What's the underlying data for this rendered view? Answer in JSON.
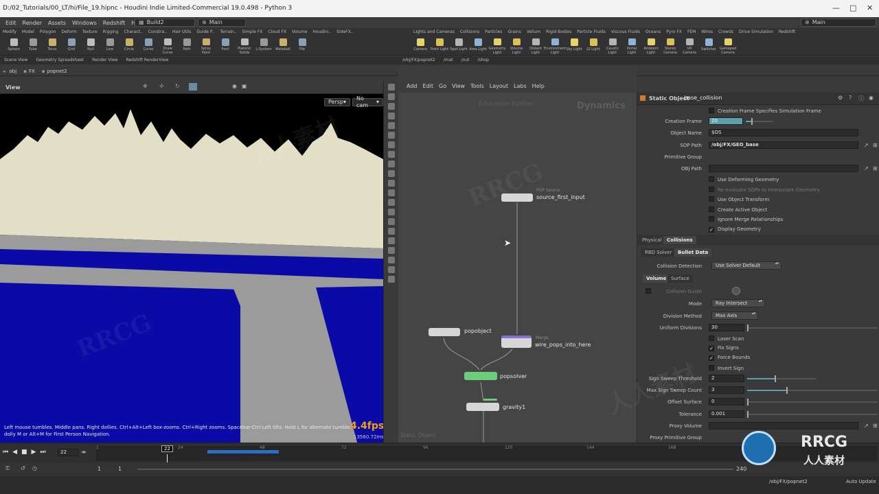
{
  "window": {
    "title": "D:/02_Tutorials/00_LT/hi/File_19.hipnc - Houdini Indie Limited-Commercial 19.0.498 - Python 3",
    "minimize": "—",
    "maximize": "□",
    "close": "✕"
  },
  "menubar": {
    "items": [
      "Edit",
      "Render",
      "Assets",
      "Windows",
      "Redshift",
      "Help"
    ],
    "desktop": "Build2",
    "desktop_right": "Main",
    "context": "Main"
  },
  "shelf_left": {
    "tabs": [
      "Modify",
      "Model",
      "Polygon",
      "Deform",
      "Texture",
      "Rigging",
      "Charact..",
      "Constra..",
      "Hair Utils",
      "Guide P..",
      "Terrain..",
      "Simple FX",
      "Cloud FX",
      "Volume",
      "Houdini..",
      "SideFX.."
    ],
    "tools": [
      "Sphere",
      "Tube",
      "Torus",
      "Grid",
      "Null",
      "Line",
      "Circle",
      "Curve",
      "Draw Curve",
      "Path",
      "Spray Paint",
      "Font",
      "Platonic Solids",
      "L-System",
      "Metaball",
      "File"
    ]
  },
  "shelf_right": {
    "tabs": [
      "Lights and Cameras",
      "Collisions",
      "Particles",
      "Grains",
      "Vellum",
      "Rigid Bodies",
      "Particle Fluids",
      "Viscous Fluids",
      "Oceans",
      "Pyro FX",
      "FEM",
      "Wires",
      "Crowds",
      "Drive Simulation",
      "Redshift"
    ],
    "tools": [
      "Camera",
      "Point Light",
      "Spot Light",
      "Area Light",
      "Geometry Light",
      "Volume Light",
      "Distant Light",
      "Environment Light",
      "Sky Light",
      "GI Light",
      "Caustic Light",
      "Portal Light",
      "Ambient Light",
      "Stereo Camera",
      "VR Camera",
      "Switcher",
      "Gamepad Camera"
    ]
  },
  "left_pane": {
    "tabs": [
      "Scene View",
      "Geometry Spreadsheet",
      "Render View",
      "Redshift RenderView"
    ],
    "path": [
      "obj",
      "FX",
      "popnet2"
    ],
    "view_label": "View",
    "persp": "Persp",
    "cam": "No cam",
    "hint": "Left mouse tumbles. Middle pans. Right dollies. Ctrl+Alt+Left box-zooms. Ctrl+Right zooms. Spacebar-Ctrl-Left tilts. Hold L for alternate tumble, dolly M or Alt+M for First Person Navigation.",
    "fps": "4.4fps",
    "ms": "13560.72ms"
  },
  "network": {
    "tabs": [
      "/obj/FX/popnet2",
      "/mat",
      "/out",
      "/shop"
    ],
    "path": [
      "obj",
      "FX",
      "popnet2"
    ],
    "menu": [
      "Add",
      "Edit",
      "Go",
      "View",
      "Tools",
      "Layout",
      "Labs",
      "Help"
    ],
    "edition": "Education Edition",
    "context": "Dynamics",
    "bottom_label": "Static Object",
    "nodes": {
      "source": {
        "type": "POP Source",
        "name": "source_first_input"
      },
      "popobject": {
        "name": "popobject"
      },
      "merge": {
        "type": "Merge",
        "name": "wire_pops_into_here"
      },
      "popsolver": {
        "name": "popsolver"
      },
      "gravity": {
        "name": "gravity1"
      }
    }
  },
  "params": {
    "node_type": "Static Object",
    "node_name": "base_collision",
    "creation_frame_specifies": "Creation Frame Specifies Simulation Frame",
    "creation_frame_label": "Creation Frame",
    "creation_frame": "20",
    "object_name_label": "Object Name",
    "object_name": "$OS",
    "sop_path_label": "SOP Path",
    "sop_path": "/obj/FX/GEO_base",
    "primitive_group_label": "Primitive Group",
    "obj_path_label": "OBJ Path",
    "checks": [
      {
        "label": "Use Deforming Geometry",
        "on": false,
        "dim": false
      },
      {
        "label": "Re-evaluate SOPs to Interpolate Geometry",
        "on": false,
        "dim": true
      },
      {
        "label": "Use Object Transform",
        "on": false,
        "dim": false
      },
      {
        "label": "Create Active Object",
        "on": false,
        "dim": false
      },
      {
        "label": "Ignore Merge Relationships",
        "on": false,
        "dim": false
      },
      {
        "label": "Display Geometry",
        "on": true,
        "dim": false
      }
    ],
    "tabs": [
      "Physical",
      "Collisions"
    ],
    "subtabs": [
      "RBD Solver",
      "Bullet Data"
    ],
    "collision_detection_label": "Collision Detection",
    "collision_detection": "Use Solver Default",
    "vol_tabs": [
      "Volume",
      "Surface"
    ],
    "collision_guide": "Collision Guide",
    "mode_label": "Mode",
    "mode": "Ray Intersect",
    "division_method_label": "Division Method",
    "division_method": "Max Axis",
    "uniform_divisions_label": "Uniform Divisions",
    "uniform_divisions": "30",
    "laser_scan": "Laser Scan",
    "fix_signs": "Fix Signs",
    "force_bounds": "Force Bounds",
    "invert_sign": "Invert Sign",
    "sign_sweep_threshold_label": "Sign Sweep Threshold",
    "sign_sweep_threshold": "2",
    "sign_sweep_threshold_frac": 0.4,
    "max_sign_sweep_count_label": "Max Sign Sweep Count",
    "max_sign_sweep_count": "3",
    "max_sign_sweep_count_frac": 0.3,
    "offset_surface_label": "Offset Surface",
    "offset_surface": "0",
    "tolerance_label": "Tolerance",
    "tolerance": "0.001",
    "proxy_volume_label": "Proxy Volume",
    "proxy_primitive_group_label": "Proxy Primitive Group",
    "creation_frame_frac": 0.2
  },
  "timeline": {
    "current_frame": "22",
    "ticks": [
      "1",
      "24",
      "48",
      "72",
      "96",
      "120",
      "144",
      "168"
    ],
    "range_start": "1",
    "range_start2": "1",
    "range_end": "240",
    "frame_marker": "22"
  },
  "status": {
    "path": "/obj/FX/popnet2",
    "auto_update": "Auto Update"
  },
  "colors": {
    "sky": "#000000",
    "foam": "#e3dfc6",
    "water": "#0a0aa6",
    "ground": "#9b9b9b",
    "accent": "#5f9ead"
  }
}
